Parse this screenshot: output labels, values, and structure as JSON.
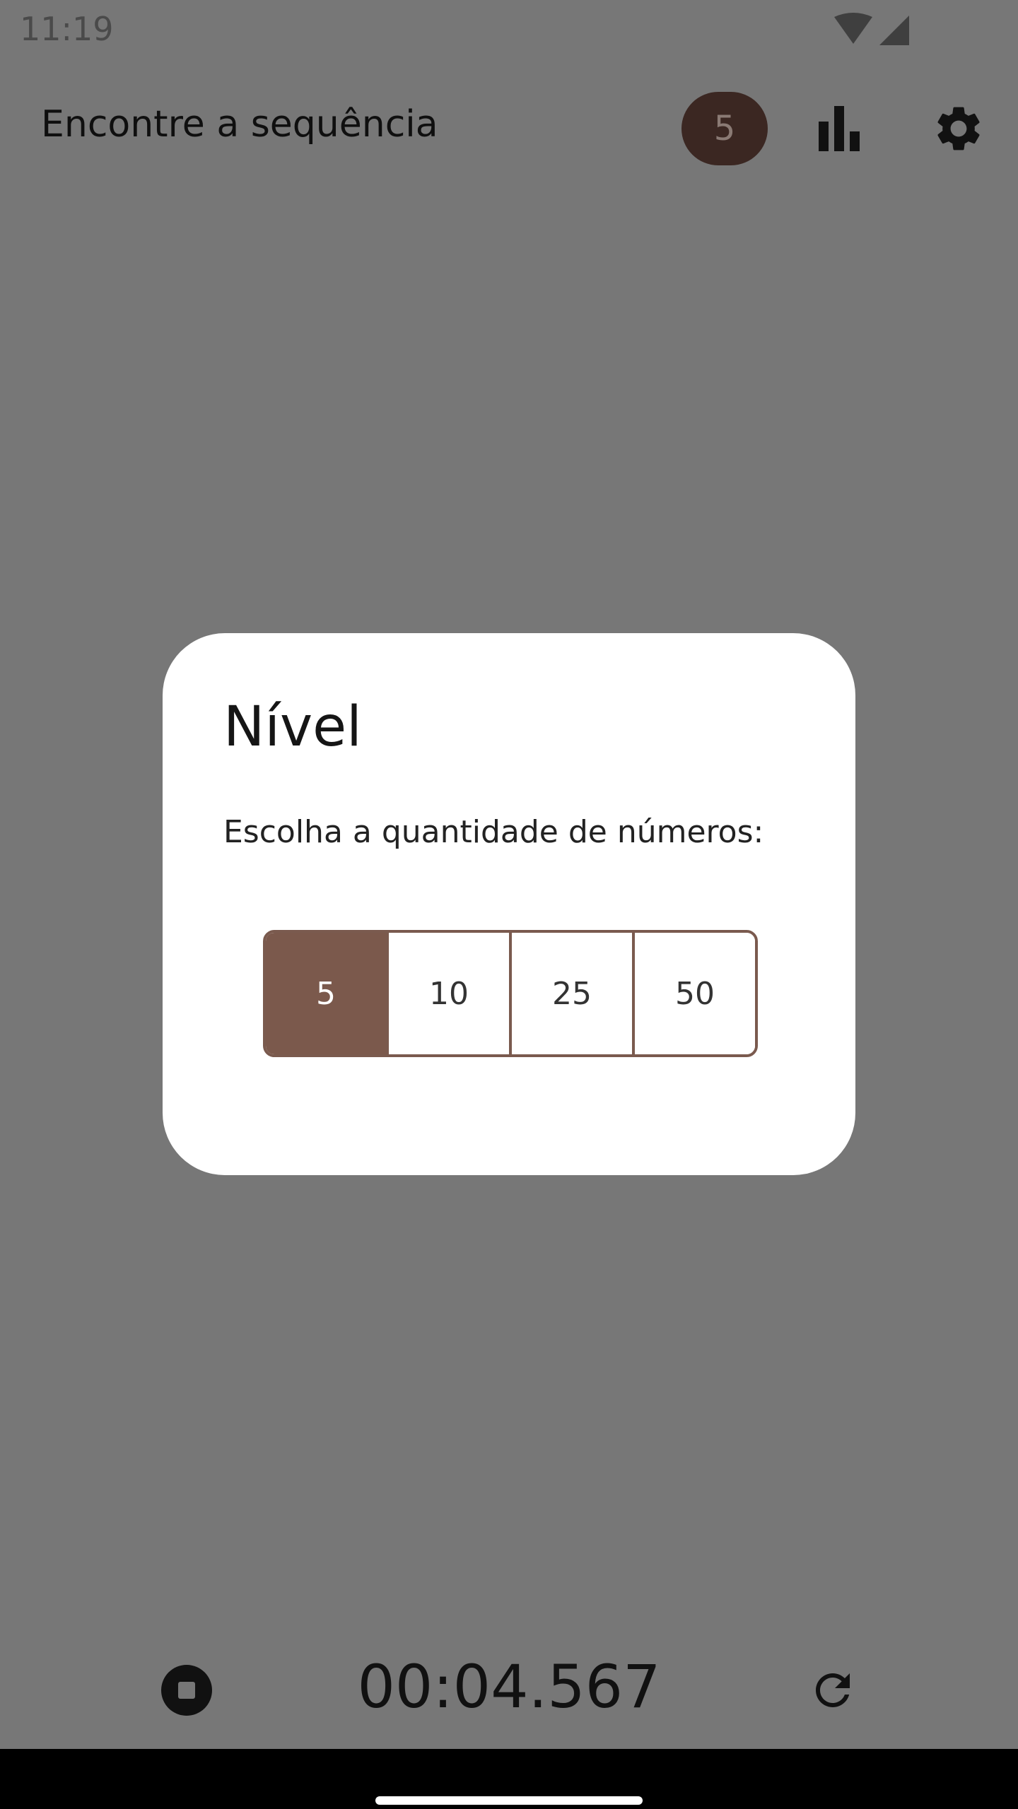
{
  "status_bar": {
    "time": "11:19",
    "icons": [
      "wifi-icon",
      "signal-icon"
    ]
  },
  "app_bar": {
    "title": "Encontre a sequência",
    "level_badge": "5",
    "actions": [
      "stats-icon",
      "settings-icon"
    ]
  },
  "dialog": {
    "title": "Nível",
    "message": "Escolha a quantidade de números:",
    "options": [
      "5",
      "10",
      "25",
      "50"
    ],
    "selected": "5"
  },
  "footer": {
    "timer": "00:04.567",
    "left_icon": "stop-icon",
    "right_icon": "refresh-icon"
  },
  "colors": {
    "scrim": "#777777",
    "accent": "#7b594c",
    "badge": "#3b2722",
    "dialog_bg": "#ffffff"
  }
}
